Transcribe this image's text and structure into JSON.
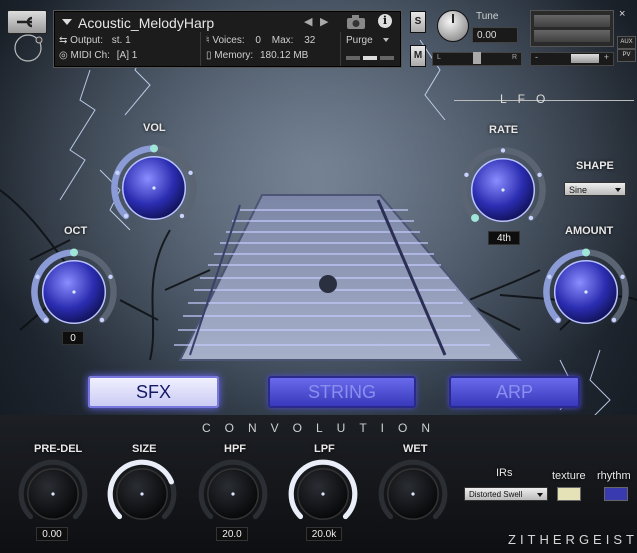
{
  "header": {
    "instrument_name": "Acoustic_MelodyHarp",
    "output_label": "Output:",
    "output_value": "st. 1",
    "voices_label": "Voices:",
    "voices_value": "0",
    "max_label": "Max:",
    "max_value": "32",
    "purge_label": "Purge",
    "midi_label": "MIDI Ch:",
    "midi_value": "[A] 1",
    "memory_label": "Memory:",
    "memory_value": "180.12 MB",
    "solo_label": "S",
    "mute_label": "M",
    "tune_label": "Tune",
    "tune_value": "0.00",
    "pan_left": "L",
    "pan_right": "R",
    "vol_minus": "-",
    "vol_plus": "+",
    "aux_label": "AUX",
    "pv_label": "PV",
    "close_symbol": "×",
    "info_symbol": "i"
  },
  "knobs": {
    "vol": {
      "label": "VOL",
      "level": 0.5
    },
    "oct": {
      "label": "OCT",
      "value": "0",
      "level": 0.5
    },
    "lfo_rate": {
      "label": "RATE",
      "value": "4th",
      "level": 0.0
    },
    "lfo_amount": {
      "label": "AMOUNT",
      "level": 0.5
    }
  },
  "lfo": {
    "title": "LFO",
    "shape_label": "SHAPE",
    "shape_value": "Sine"
  },
  "modes": [
    {
      "label": "SFX",
      "active": true
    },
    {
      "label": "STRING",
      "active": false
    },
    {
      "label": "ARP",
      "active": false
    }
  ],
  "convolution": {
    "title": "CONVOLUTION",
    "predel": {
      "label": "PRE-DEL",
      "value": "0.00",
      "level": 0.0
    },
    "size": {
      "label": "SIZE",
      "level": 0.75
    },
    "hpf": {
      "label": "HPF",
      "value": "20.0",
      "level": 0.0
    },
    "lpf": {
      "label": "LPF",
      "value": "20.0k",
      "level": 1.0
    },
    "wet": {
      "label": "WET",
      "level": 0.0
    },
    "irs_label": "IRs",
    "irs_value": "Distorted Swell",
    "texture_label": "texture",
    "rhythm_label": "rhythm"
  },
  "brand": "ZITHERGEIST",
  "colors": {
    "accent_blue": "#5656ff",
    "knob_glow": "#dfe6ff",
    "texture_swatch": "#e6e2b8",
    "rhythm_swatch": "#3a3ab0"
  }
}
